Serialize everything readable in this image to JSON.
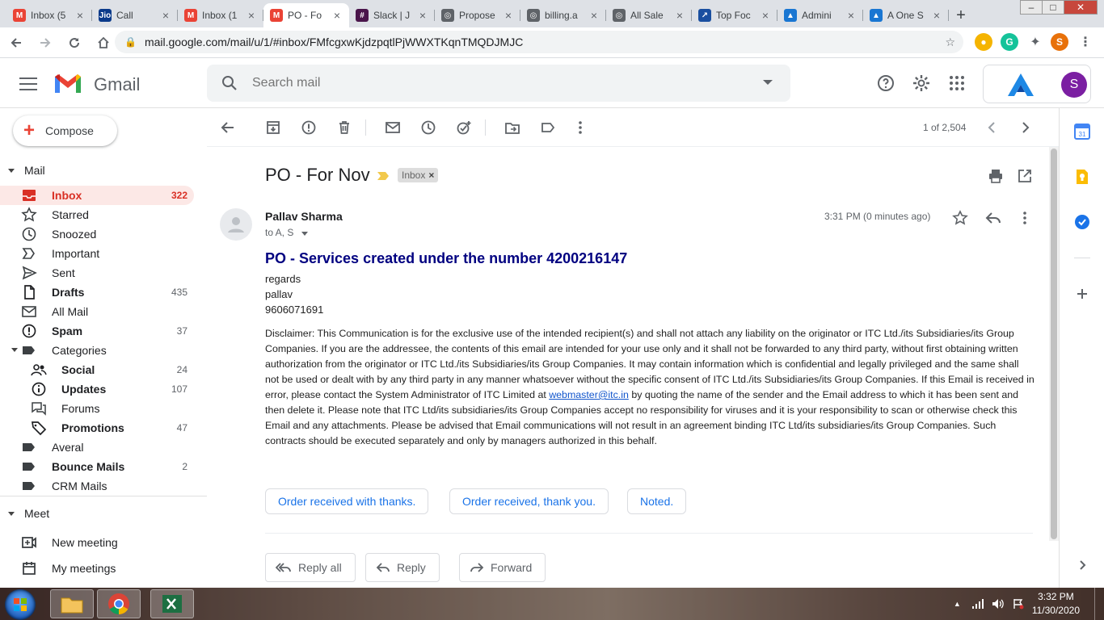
{
  "browser": {
    "tabs": [
      {
        "title": "Inbox (5",
        "favicon": "gmail",
        "color": "#ea4335",
        "glyph": "M"
      },
      {
        "title": "Call",
        "favicon": "jio",
        "color": "#0a3a8a",
        "glyph": "Jio"
      },
      {
        "title": "Inbox (1",
        "favicon": "gmail",
        "color": "#ea4335",
        "glyph": "M"
      },
      {
        "title": "PO - Fo",
        "favicon": "gmail",
        "color": "#ea4335",
        "glyph": "M",
        "active": true
      },
      {
        "title": "Slack | J",
        "favicon": "slack",
        "color": "#4a154b",
        "glyph": "#"
      },
      {
        "title": "Propose",
        "favicon": "globe",
        "color": "#5f6368",
        "glyph": "◎"
      },
      {
        "title": "billing.a",
        "favicon": "globe",
        "color": "#5f6368",
        "glyph": "◎"
      },
      {
        "title": "All Sale",
        "favicon": "globe",
        "color": "#5f6368",
        "glyph": "◎"
      },
      {
        "title": "Top Foc",
        "favicon": "app",
        "color": "#1a4fa0",
        "glyph": "↗"
      },
      {
        "title": "Admini",
        "favicon": "brand",
        "color": "#1976d2",
        "glyph": "▲"
      },
      {
        "title": "A One S",
        "favicon": "brand",
        "color": "#1976d2",
        "glyph": "▲"
      }
    ],
    "url": "mail.google.com/mail/u/1/#inbox/FMfcgxwKjdzpqtlPjWWXTKqnTMQDJMJC",
    "profile_initial": "S"
  },
  "gmail": {
    "app_name": "Gmail",
    "search_placeholder": "Search mail",
    "avatar_initial": "S",
    "compose_label": "Compose",
    "mail_section": "Mail",
    "meet_section": "Meet",
    "nav": [
      {
        "label": "Inbox",
        "count": "322",
        "icon": "inbox-icon",
        "active": true,
        "bold": true
      },
      {
        "label": "Starred",
        "count": "",
        "icon": "star-icon"
      },
      {
        "label": "Snoozed",
        "count": "",
        "icon": "clock-icon"
      },
      {
        "label": "Important",
        "count": "",
        "icon": "important-icon"
      },
      {
        "label": "Sent",
        "count": "",
        "icon": "send-icon"
      },
      {
        "label": "Drafts",
        "count": "435",
        "icon": "draft-icon",
        "bold": true
      },
      {
        "label": "All Mail",
        "count": "",
        "icon": "mail-icon"
      },
      {
        "label": "Spam",
        "count": "37",
        "icon": "spam-icon",
        "bold": true
      },
      {
        "label": "Categories",
        "count": "",
        "icon": "label-icon",
        "expander": true
      },
      {
        "label": "Social",
        "count": "24",
        "icon": "people-icon",
        "bold": true,
        "sub": true
      },
      {
        "label": "Updates",
        "count": "107",
        "icon": "info-icon",
        "bold": true,
        "sub": true
      },
      {
        "label": "Forums",
        "count": "",
        "icon": "forum-icon",
        "sub": true
      },
      {
        "label": "Promotions",
        "count": "47",
        "icon": "tag-icon",
        "bold": true,
        "sub": true
      },
      {
        "label": "Averal",
        "count": "",
        "icon": "label-icon"
      },
      {
        "label": "Bounce Mails",
        "count": "2",
        "icon": "label-icon",
        "bold": true
      },
      {
        "label": "CRM Mails",
        "count": "",
        "icon": "label-icon"
      }
    ],
    "meet": [
      {
        "label": "New meeting",
        "icon": "video-icon"
      },
      {
        "label": "My meetings",
        "icon": "calendar-icon"
      }
    ],
    "pager": "1 of 2,504"
  },
  "email": {
    "subject": "PO - For Nov",
    "label": "Inbox",
    "sender": "Pallav Sharma",
    "recipients": "to A, S",
    "time": "3:31 PM (0 minutes ago)",
    "heading": "PO - Services created under the number 4200216147",
    "signature": [
      "regards",
      "pallav",
      "9606071691"
    ],
    "disclaimer_before": "Disclaimer: This Communication is for the exclusive use of the intended recipient(s) and shall not attach any liability on the originator or ITC Ltd./its Subsidiaries/its Group Companies. If you are the addressee, the contents of this email are intended for your use only and it shall not be forwarded to any third party, without first obtaining written authorization from the originator or ITC Ltd./its Subsidiaries/its Group Companies. It may contain information which is confidential and legally privileged and the same shall not be used or dealt with by any third party in any manner whatsoever without the specific consent of ITC Ltd./its Subsidiaries/its Group Companies. If this Email is received in error, please contact the System Administrator of ITC Limited at ",
    "disclaimer_link": "webmaster@itc.in",
    "disclaimer_after": " by quoting the name of the sender and the Email address to which it has been sent and then delete it. Please note that ITC Ltd/its subsidiaries/its Group Companies accept no responsibility for viruses and it is your responsibility to scan or otherwise check this Email and any attachments. Please be advised that Email communications will not result in an agreement binding ITC Ltd/its subsidiaries/its Group Companies. Such contracts should be executed separately and only by managers authorized in this behalf.",
    "smart_replies": [
      "Order received with thanks.",
      "Order received, thank you.",
      "Noted."
    ],
    "reply_all": "Reply all",
    "reply": "Reply",
    "forward": "Forward"
  },
  "taskbar": {
    "time": "3:32 PM",
    "date": "11/30/2020"
  }
}
